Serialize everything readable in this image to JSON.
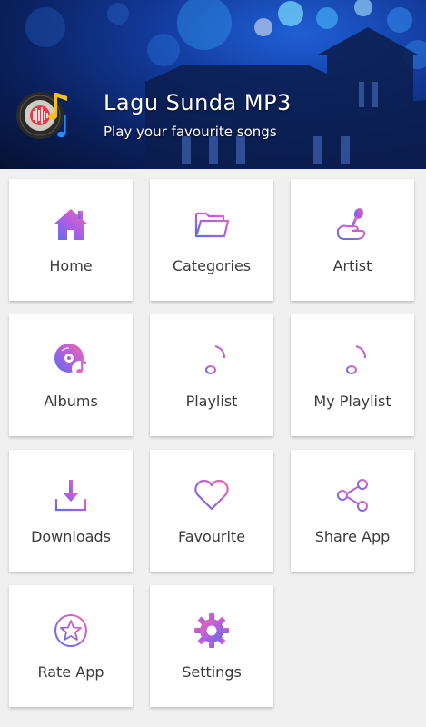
{
  "header": {
    "title": "Lagu Sunda MP3",
    "subtitle": "Play your favourite songs",
    "logo_icon": "vinyl-music-note-icon",
    "background_color": "#0a1f5a"
  },
  "accent_gradient": [
    "#5b6ee8",
    "#c95bd6",
    "#f06aa3"
  ],
  "menu": [
    {
      "label": "Home",
      "icon": "home-icon"
    },
    {
      "label": "Categories",
      "icon": "folder-icon"
    },
    {
      "label": "Artist",
      "icon": "microphone-icon"
    },
    {
      "label": "Albums",
      "icon": "album-disc-icon"
    },
    {
      "label": "Playlist",
      "icon": "playlist-icon"
    },
    {
      "label": "My Playlist",
      "icon": "my-playlist-icon"
    },
    {
      "label": "Downloads",
      "icon": "download-icon"
    },
    {
      "label": "Favourite",
      "icon": "heart-icon"
    },
    {
      "label": "Share App",
      "icon": "share-icon"
    },
    {
      "label": "Rate App",
      "icon": "star-icon"
    },
    {
      "label": "Settings",
      "icon": "gear-icon"
    }
  ]
}
